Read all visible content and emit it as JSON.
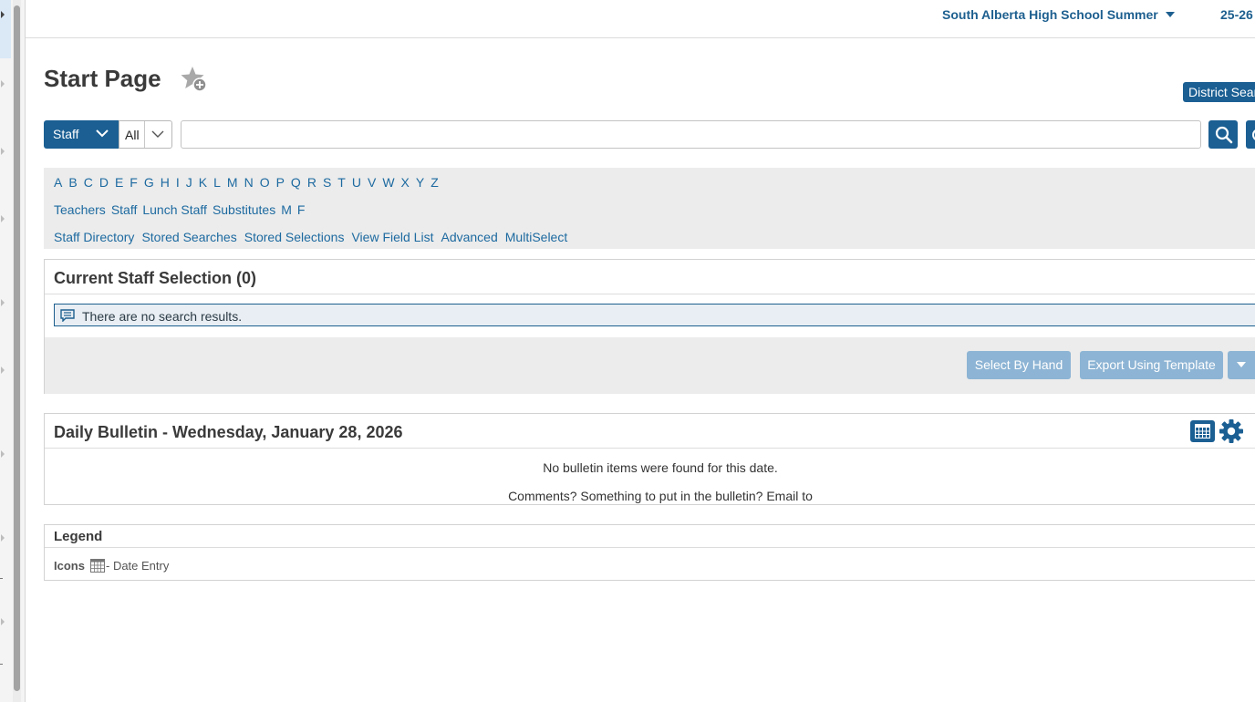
{
  "header": {
    "school": "South Alberta High School Summer",
    "year": "25-26"
  },
  "page": {
    "title": "Start Page",
    "district_search_label": "District Search"
  },
  "search": {
    "scope": "Staff",
    "filter": "All",
    "value": "",
    "placeholder": ""
  },
  "letters": [
    "A",
    "B",
    "C",
    "D",
    "E",
    "F",
    "G",
    "H",
    "I",
    "J",
    "K",
    "L",
    "M",
    "N",
    "O",
    "P",
    "Q",
    "R",
    "S",
    "T",
    "U",
    "V",
    "W",
    "X",
    "Y",
    "Z"
  ],
  "groups": [
    "Teachers",
    "Staff",
    "Lunch Staff",
    "Substitutes",
    "M",
    "F"
  ],
  "links": [
    "Staff Directory",
    "Stored Searches",
    "Stored Selections",
    "View Field List",
    "Advanced",
    "MultiSelect"
  ],
  "selection": {
    "title": "Current Staff Selection (0)",
    "message": "There are no search results.",
    "select_by_hand": "Select By Hand",
    "export_template": "Export Using Template"
  },
  "bulletin": {
    "title": "Daily Bulletin - Wednesday, January 28, 2026",
    "empty_message": "No bulletin items were found for this date.",
    "comments": "Comments? Something to put in the bulletin? Email to"
  },
  "legend": {
    "title": "Legend",
    "icons_label": "Icons",
    "date_entry": "- Date Entry"
  },
  "colors": {
    "primary": "#1b5f93",
    "link": "#1d6aa0",
    "disabled_button": "#8db4d4",
    "panel_bg": "#ececec"
  },
  "icons": [
    "favorite-add-icon",
    "chevron-down-icon",
    "search-icon",
    "message-icon",
    "calendar-icon",
    "gear-icon"
  ]
}
